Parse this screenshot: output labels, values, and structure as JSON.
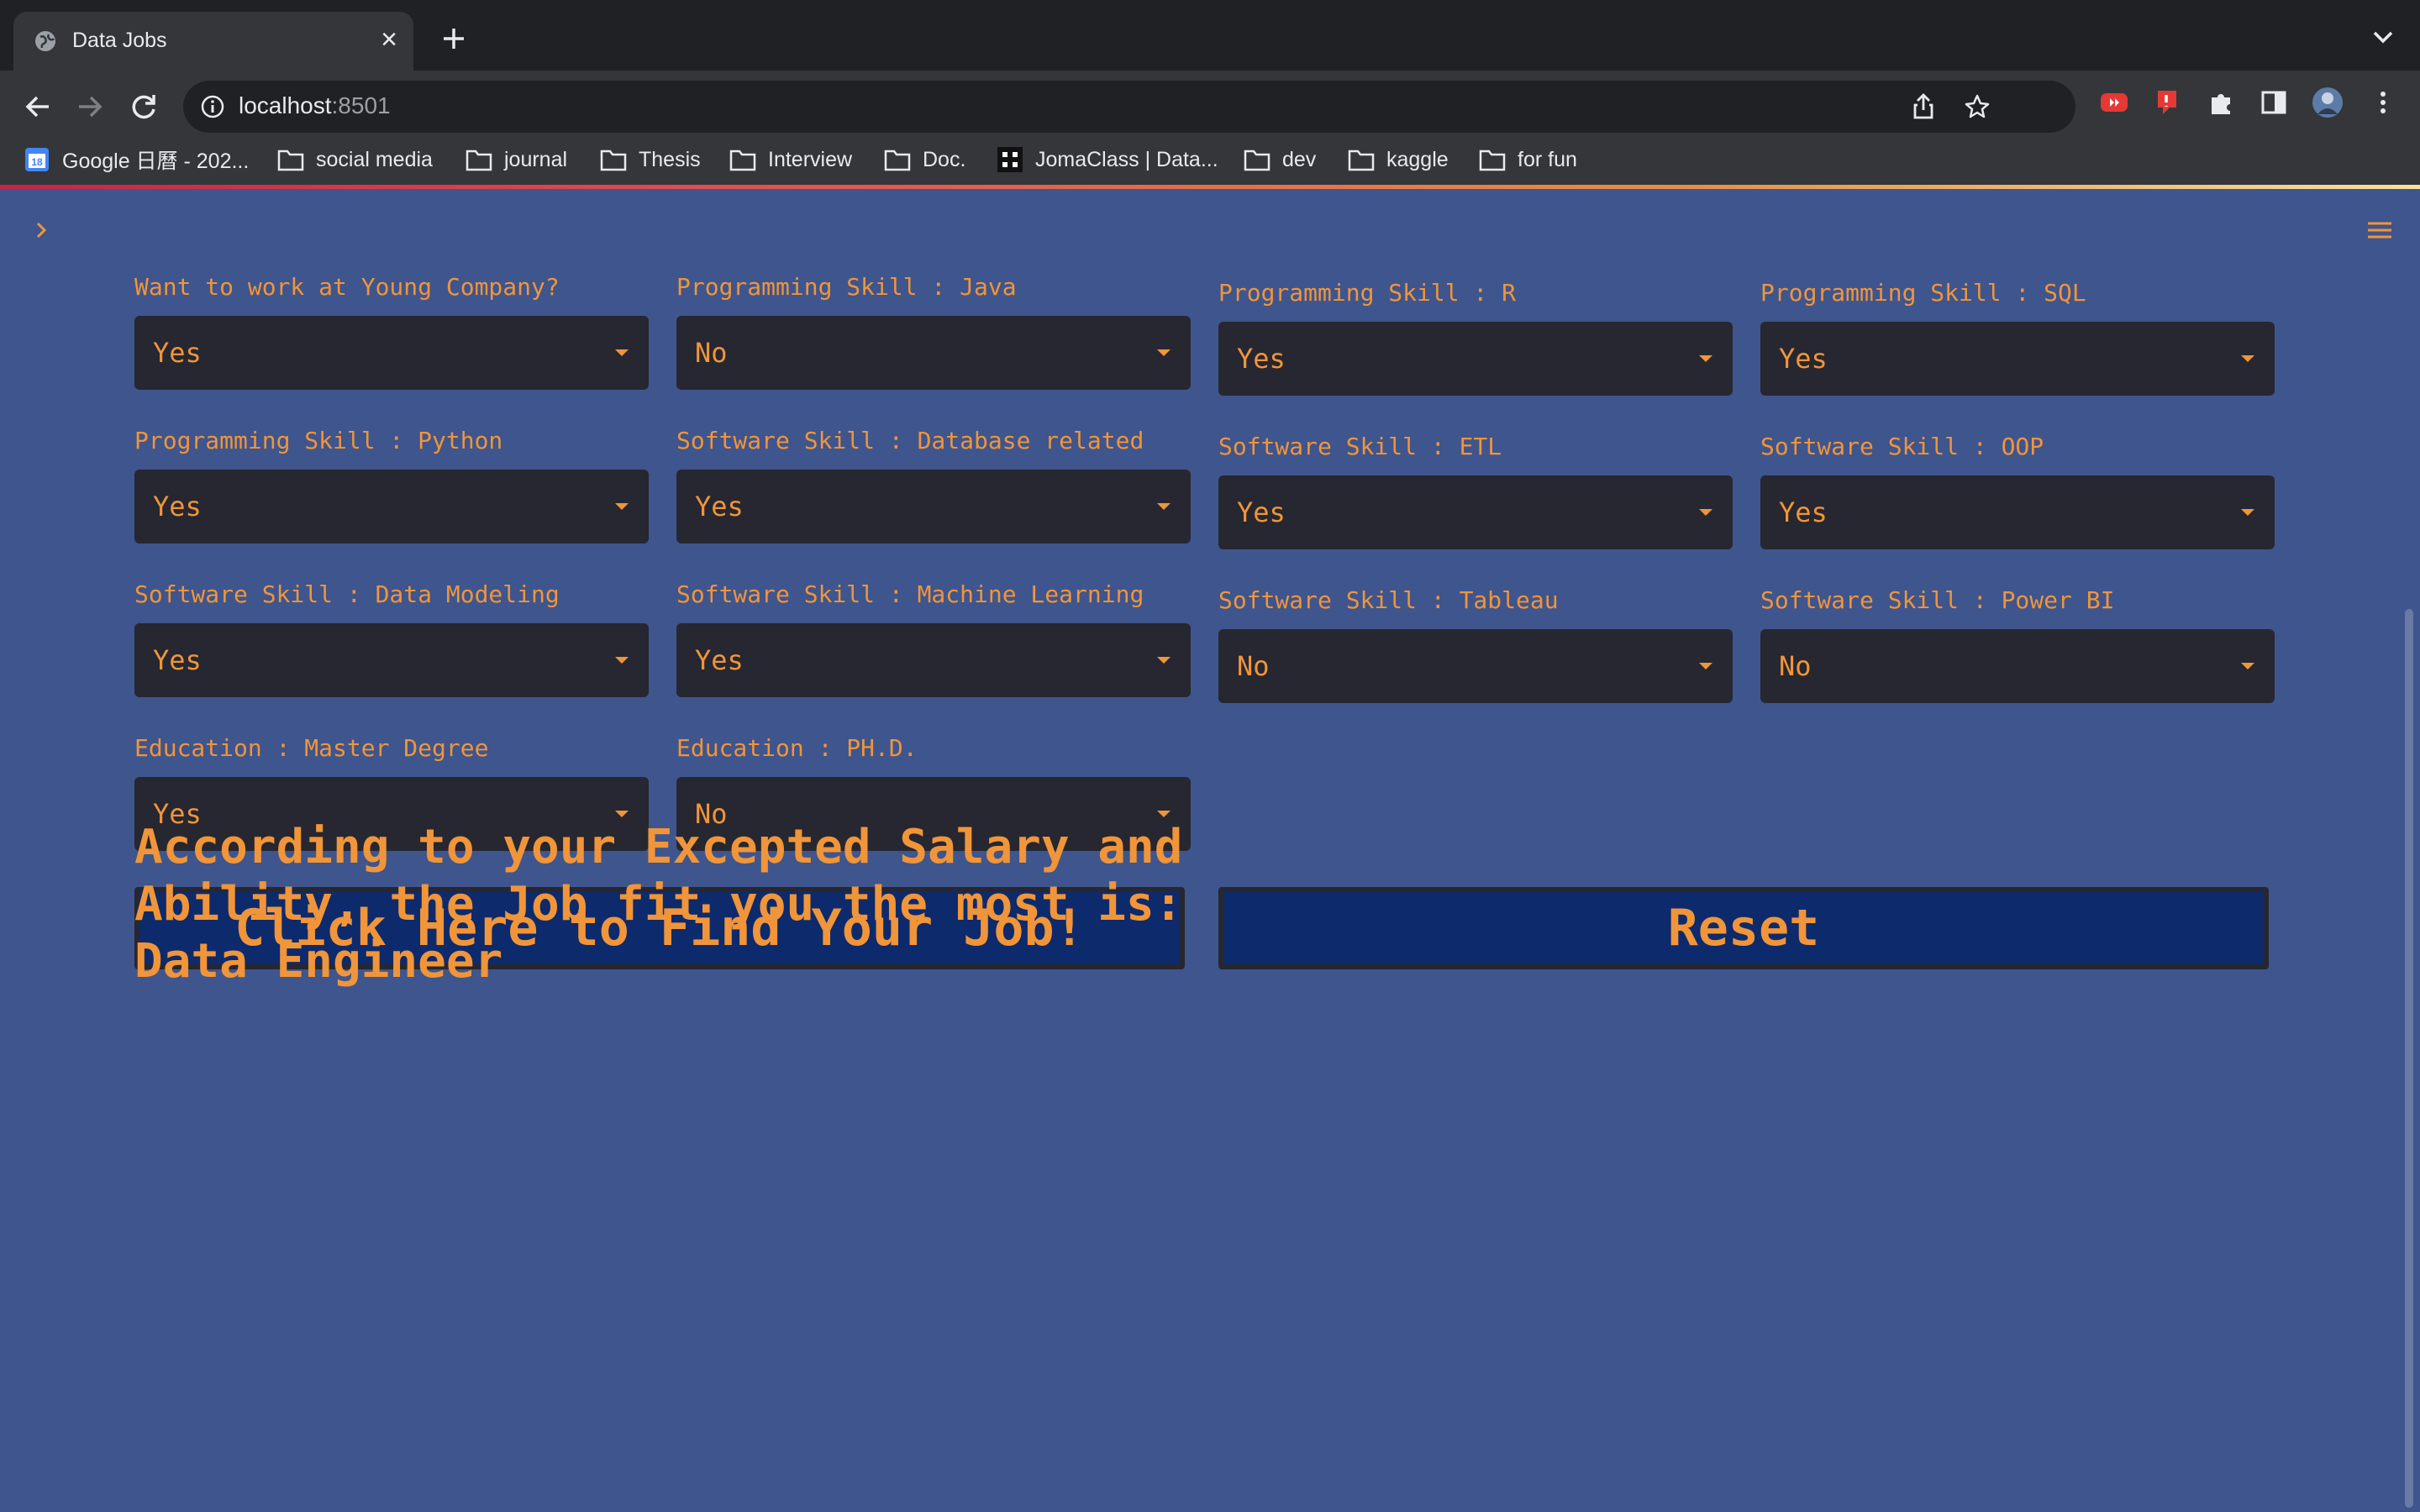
{
  "browser": {
    "tab_title": "Data Jobs",
    "url_host": "localhost",
    "url_port": ":8501",
    "bookmarks": [
      {
        "label": "Google 日曆 - 202...",
        "icon": "calendar-icon"
      },
      {
        "label": "social media",
        "icon": "folder-icon"
      },
      {
        "label": "journal",
        "icon": "folder-icon"
      },
      {
        "label": "Thesis",
        "icon": "folder-icon"
      },
      {
        "label": "Interview",
        "icon": "folder-icon"
      },
      {
        "label": "Doc.",
        "icon": "folder-icon"
      },
      {
        "label": "JomaClass | Data...",
        "icon": "jomaclass-icon"
      },
      {
        "label": "dev",
        "icon": "folder-icon"
      },
      {
        "label": "kaggle",
        "icon": "folder-icon"
      },
      {
        "label": "for fun",
        "icon": "folder-icon"
      }
    ]
  },
  "form": {
    "fields": [
      {
        "label": "Want to work at Young Company?",
        "value": "Yes"
      },
      {
        "label": "Programming Skill : Java",
        "value": "No"
      },
      {
        "label": "Programming Skill : R",
        "value": "Yes"
      },
      {
        "label": "Programming Skill : SQL",
        "value": "Yes"
      },
      {
        "label": "Programming Skill : Python",
        "value": "Yes"
      },
      {
        "label": "Software Skill : Database related",
        "value": "Yes"
      },
      {
        "label": "Software Skill : ETL",
        "value": "Yes"
      },
      {
        "label": "Software Skill : OOP",
        "value": "Yes"
      },
      {
        "label": "Software Skill : Data Modeling",
        "value": "Yes"
      },
      {
        "label": "Software Skill : Machine Learning",
        "value": "Yes"
      },
      {
        "label": "Software Skill : Tableau",
        "value": "No"
      },
      {
        "label": "Software Skill : Power BI",
        "value": "No"
      },
      {
        "label": "Education : Master Degree",
        "value": "Yes"
      },
      {
        "label": "Education : PH.D.",
        "value": "No"
      }
    ],
    "find_button_label": "Click Here to Find Your Job!",
    "reset_button_label": "Reset"
  },
  "result": {
    "line1": "According to your Excepted Salary and",
    "line2": "Ability, the Job fit you the most is:",
    "line3": "Data Engineer"
  },
  "colors": {
    "background": "#3f558d",
    "accent": "#f0953a",
    "select_background": "#262730",
    "button_background": "#0d2a6c"
  }
}
